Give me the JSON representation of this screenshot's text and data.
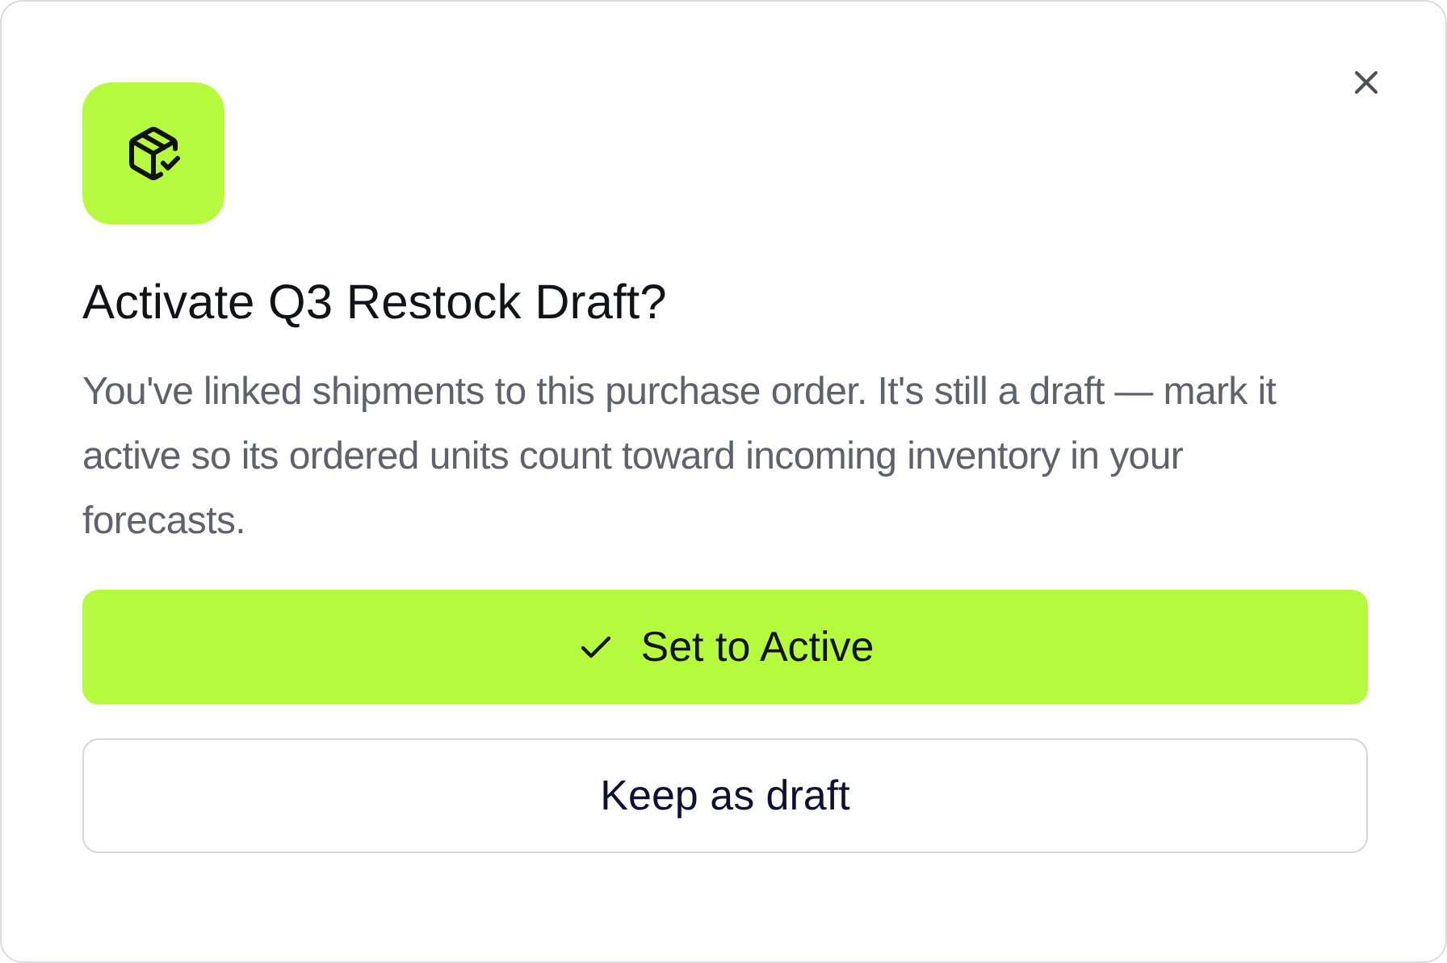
{
  "dialog": {
    "title": "Activate Q3 Restock Draft?",
    "message": "You've linked shipments to this purchase order. It's still a draft — mark it active so its ordered units count toward incoming inventory in your forecasts.",
    "buttons": [
      {
        "label": "Set to Active",
        "kind": "primary"
      },
      {
        "label": "Keep as draft",
        "kind": "secondary"
      }
    ]
  }
}
